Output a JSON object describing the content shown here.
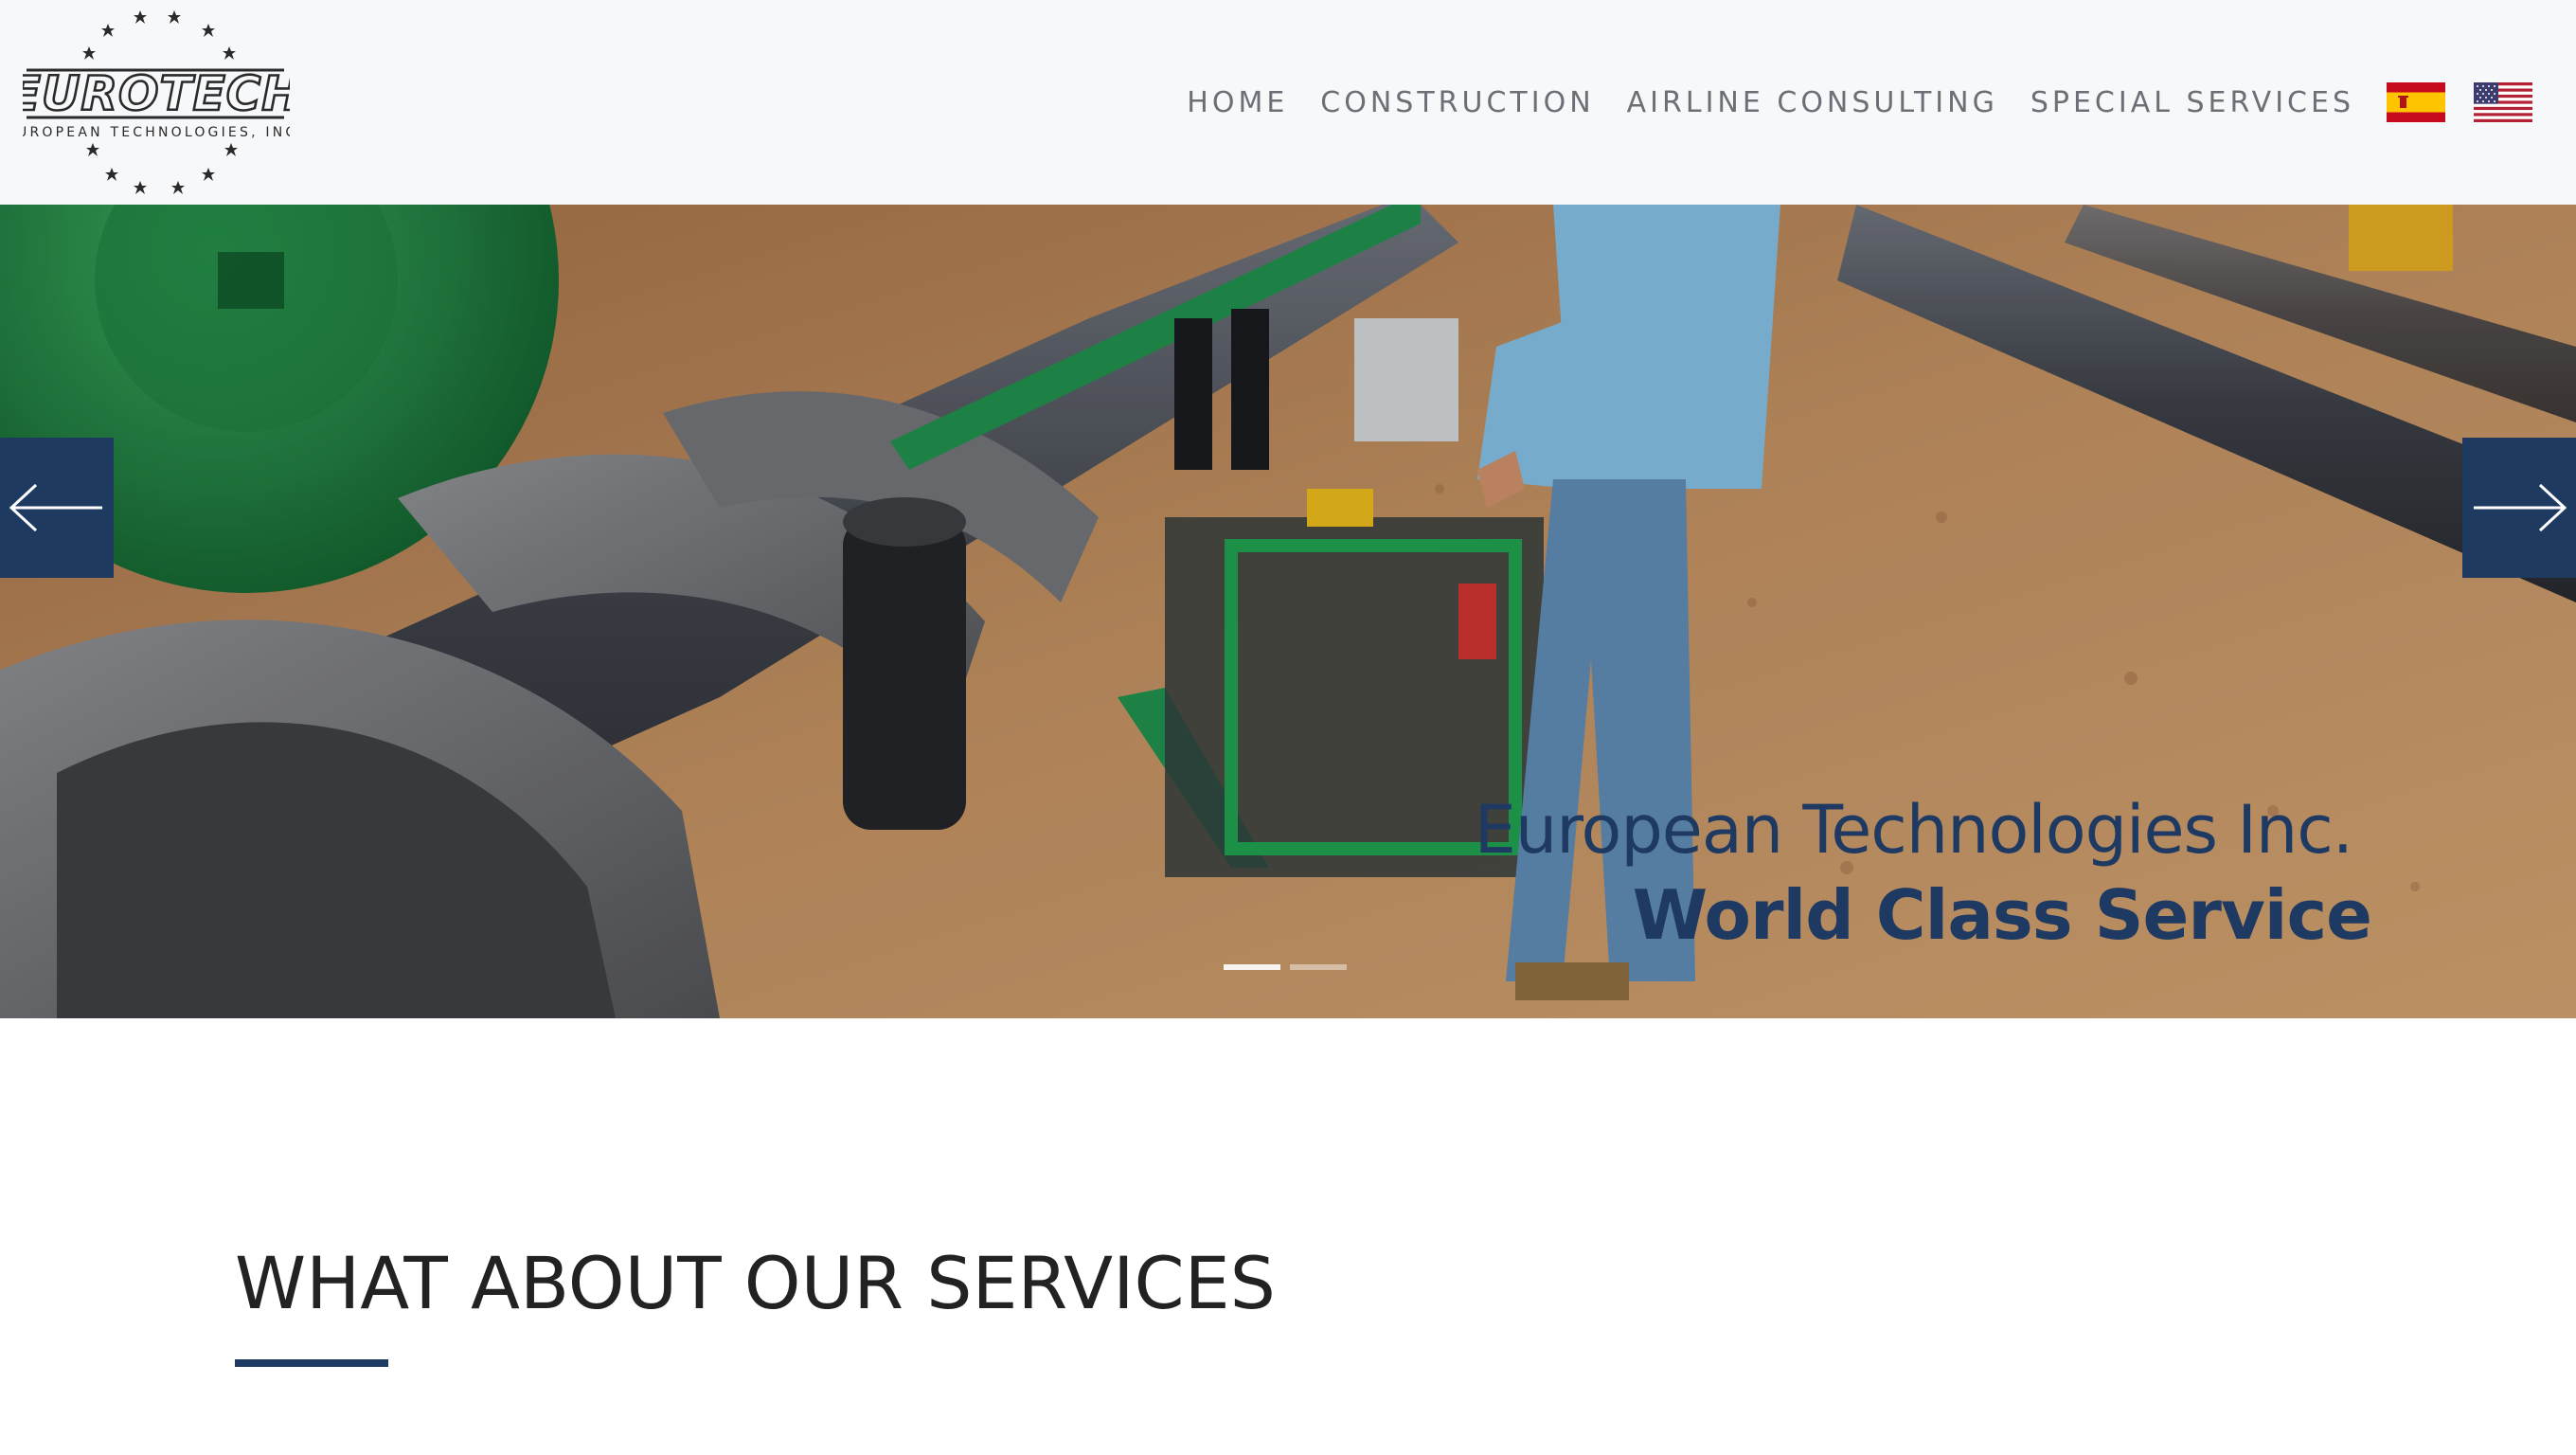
{
  "brand": {
    "logo_text": "EUROTECH",
    "logo_subtitle": "EUROPEAN TECHNOLOGIES, INC."
  },
  "nav": {
    "items": [
      "HOME",
      "CONSTRUCTION",
      "AIRLINE CONSULTING",
      "SPECIAL SERVICES"
    ],
    "flags": [
      "spanish-flag-icon",
      "us-flag-icon"
    ]
  },
  "hero": {
    "line1": "European Technologies Inc.",
    "line2": "World Class Service",
    "prev_icon": "arrow-left-icon",
    "next_icon": "arrow-right-icon",
    "slide_count": 2,
    "active_slide": 1
  },
  "services": {
    "title": "WHAT ABOUT OUR SERVICES"
  },
  "colors": {
    "accent": "#1e3a62",
    "header_bg": "#f7f8fa",
    "nav_text": "#6b6f76"
  }
}
